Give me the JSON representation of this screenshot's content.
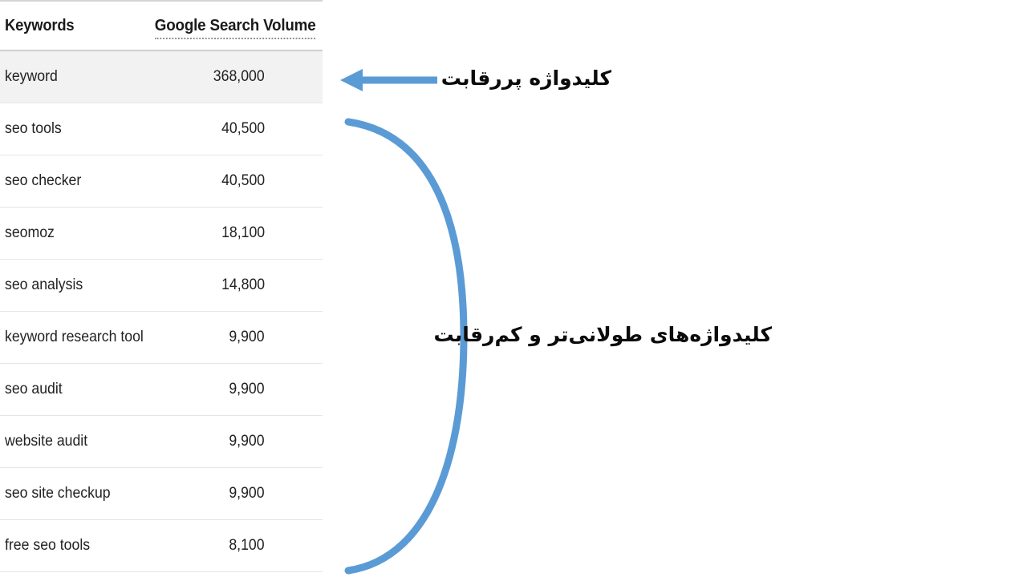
{
  "table": {
    "columns": {
      "keyword_header": "Keywords",
      "volume_header": "Google Search Volume"
    },
    "rows": [
      {
        "keyword": "keyword",
        "volume": "368,000",
        "highlighted": true
      },
      {
        "keyword": "seo tools",
        "volume": "40,500",
        "highlighted": false
      },
      {
        "keyword": "seo checker",
        "volume": "40,500",
        "highlighted": false
      },
      {
        "keyword": "seomoz",
        "volume": "18,100",
        "highlighted": false
      },
      {
        "keyword": "seo analysis",
        "volume": "14,800",
        "highlighted": false
      },
      {
        "keyword": "keyword research tool",
        "volume": "9,900",
        "highlighted": false
      },
      {
        "keyword": "seo audit",
        "volume": "9,900",
        "highlighted": false
      },
      {
        "keyword": "website audit",
        "volume": "9,900",
        "highlighted": false
      },
      {
        "keyword": "seo site checkup",
        "volume": "9,900",
        "highlighted": false
      },
      {
        "keyword": "free seo tools",
        "volume": "8,100",
        "highlighted": false
      }
    ]
  },
  "annotations": {
    "top": {
      "text": "کلیدواژه پررقابت",
      "marker": "left-arrow-icon"
    },
    "bottom": {
      "text": "کلیدواژه‌های طولانی‌تر و کم‌رقابت",
      "marker": "curly-brace-icon"
    }
  },
  "colors": {
    "accent_blue": "#5B9BD5",
    "row_highlight": "#f2f2f2",
    "row_divider": "#e6e6e6",
    "header_rule": "#cfcfcf",
    "text": "#222222"
  }
}
